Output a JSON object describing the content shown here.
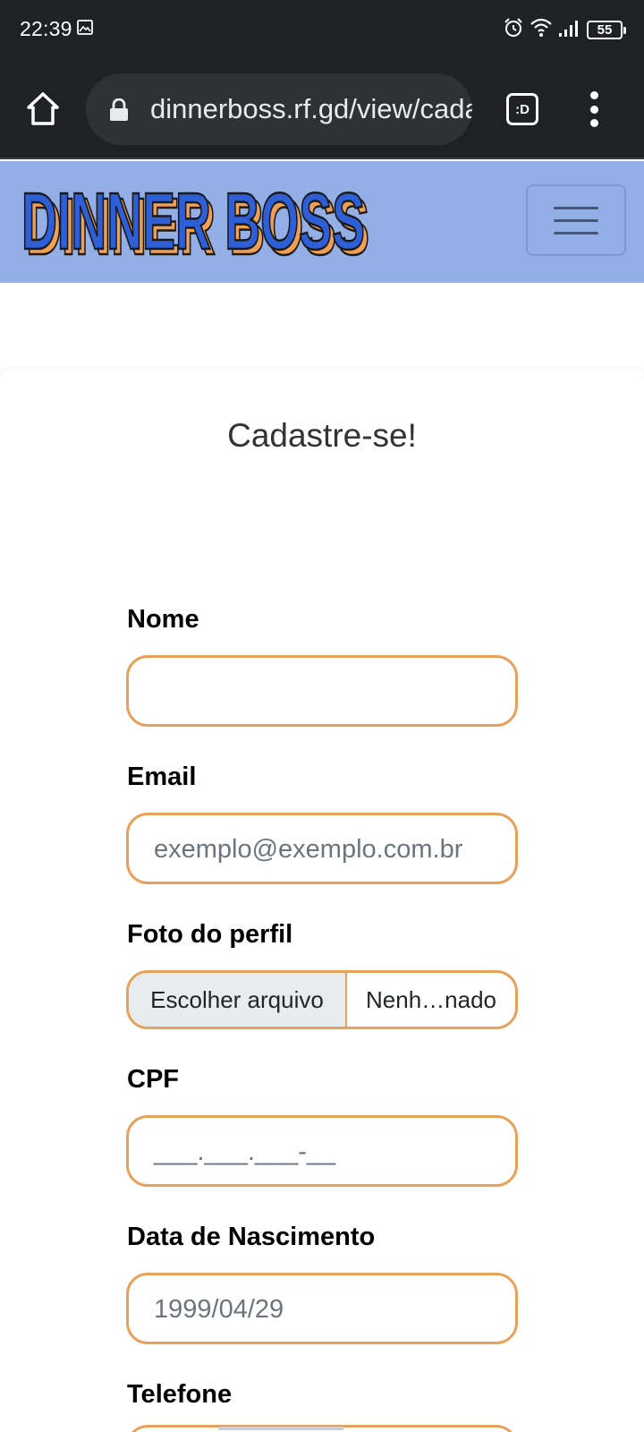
{
  "status_bar": {
    "time": "22:39",
    "battery": "55"
  },
  "browser": {
    "url": "dinnerboss.rf.gd/view/cadastro",
    "tabs_label": ":D"
  },
  "navbar": {
    "brand": "DINNER BOSS"
  },
  "form": {
    "title": "Cadastre-se!",
    "fields": {
      "nome": {
        "label": "Nome",
        "value": ""
      },
      "email": {
        "label": "Email",
        "placeholder": "exemplo@exemplo.com.br"
      },
      "foto": {
        "label": "Foto do perfil",
        "button": "Escolher arquivo",
        "file_name": "Nenh…nado"
      },
      "cpf": {
        "label": "CPF",
        "placeholder": "___.___.___-__"
      },
      "nascimento": {
        "label": "Data de Nascimento",
        "placeholder": "1999/04/29"
      },
      "telefone": {
        "label": "Telefone"
      }
    }
  },
  "colors": {
    "accent": "#e8a15a",
    "navbar": "#94aee6",
    "chrome": "#202124",
    "brand_blue": "#2f5fd6",
    "brand_orange": "#f0a055"
  }
}
